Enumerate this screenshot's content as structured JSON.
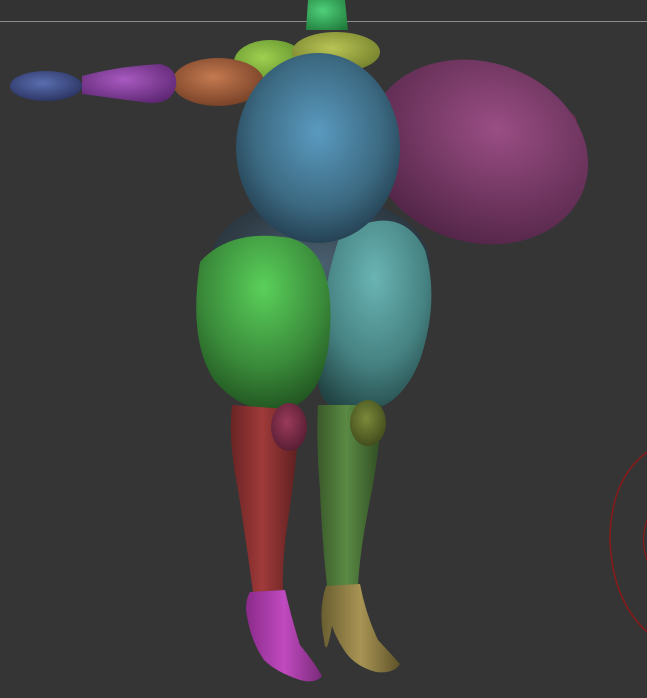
{
  "viewport": {
    "background": "#353535",
    "guide_line_color": "#8c8c8c",
    "gizmo_color": "#8a1a1a"
  },
  "model": {
    "parts": [
      {
        "name": "neck",
        "color": "#2fae55"
      },
      {
        "name": "chest",
        "color": "#9aa63a"
      },
      {
        "name": "shoulder",
        "color": "#7cb23a"
      },
      {
        "name": "left-hand",
        "color": "#3d4e86"
      },
      {
        "name": "left-forearm",
        "color": "#8a3a9a"
      },
      {
        "name": "left-upper-arm",
        "color": "#9a5a3a"
      },
      {
        "name": "right-hand",
        "color": "#7a3a5a"
      },
      {
        "name": "right-arm-bulge",
        "color": "#7a3a6a"
      },
      {
        "name": "torso",
        "color": "#3c6a80"
      },
      {
        "name": "hip-dark",
        "color": "#3a4a5a"
      },
      {
        "name": "left-thigh",
        "color": "#3f9a3f"
      },
      {
        "name": "right-thigh",
        "color": "#4a8a8e"
      },
      {
        "name": "left-knee",
        "color": "#7a2e48"
      },
      {
        "name": "right-knee",
        "color": "#5a6a30"
      },
      {
        "name": "left-shin",
        "color": "#8a3232"
      },
      {
        "name": "right-shin",
        "color": "#4a7038"
      },
      {
        "name": "left-foot",
        "color": "#a33aa3"
      },
      {
        "name": "right-foot",
        "color": "#8a7a44"
      }
    ]
  }
}
